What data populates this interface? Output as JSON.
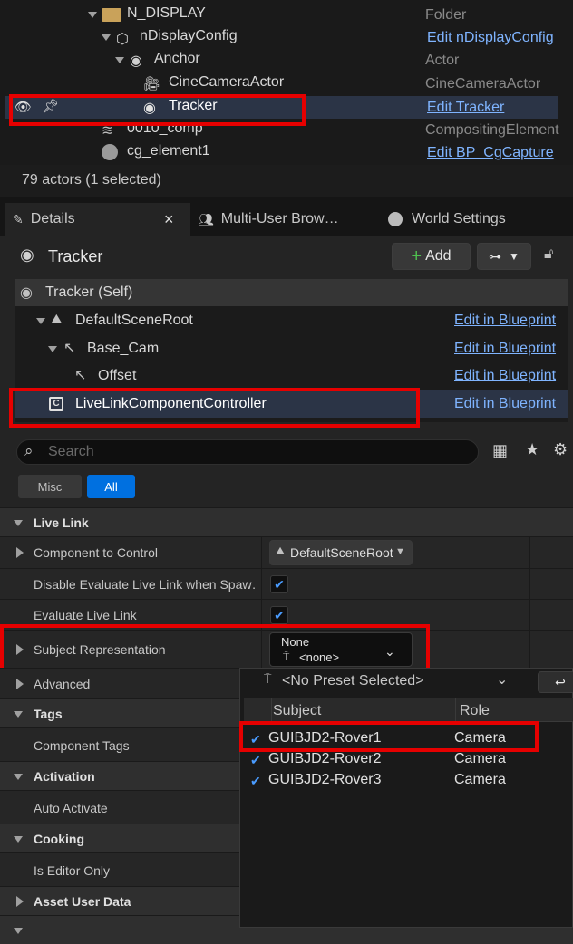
{
  "outliner": {
    "rows": [
      {
        "name": "N_DISPLAY",
        "type": "Folder"
      },
      {
        "name": "nDisplayConfig",
        "link": "Edit nDisplayConfig"
      },
      {
        "name": "Anchor",
        "type": "Actor"
      },
      {
        "name": "CineCameraActor",
        "type": "CineCameraActor"
      },
      {
        "name": "Tracker",
        "link": "Edit Tracker"
      },
      {
        "name": "0010_comp",
        "type": "CompositingElement"
      },
      {
        "name": "cg_element1",
        "link": "Edit BP_CgCapture"
      }
    ],
    "status": "79 actors (1 selected)"
  },
  "tabs": {
    "details": "Details",
    "details_close": "×",
    "multiuser": "Multi-User Brow…",
    "world": "World Settings"
  },
  "details": {
    "actor_name": "Tracker",
    "add_label": "Add",
    "components": [
      {
        "name": "Tracker (Self)"
      },
      {
        "name": "DefaultSceneRoot",
        "link": "Edit in Blueprint"
      },
      {
        "name": "Base_Cam",
        "link": "Edit in Blueprint"
      },
      {
        "name": "Offset",
        "link": "Edit in Blueprint"
      },
      {
        "name": "LiveLinkComponentController",
        "link": "Edit in Blueprint"
      }
    ],
    "search_placeholder": "Search",
    "filters": {
      "misc": "Misc",
      "all": "All"
    },
    "categories": {
      "live_link": "Live Link",
      "tags": "Tags",
      "activation": "Activation",
      "cooking": "Cooking",
      "asset_user_data": "Asset User Data"
    },
    "props": {
      "component_to_control": "Component to Control",
      "component_to_control_value": "DefaultSceneRoot",
      "disable_eval": "Disable Evaluate Live Link when Spaw…",
      "evaluate": "Evaluate Live Link",
      "subject_rep": "Subject Representation",
      "subject_rep_top": "None",
      "subject_rep_value": "<none>",
      "advanced": "Advanced",
      "component_tags": "Component Tags",
      "auto_activate": "Auto Activate",
      "editor_only": "Is Editor Only"
    }
  },
  "popup": {
    "preset": "<No Preset Selected>",
    "col_subject": "Subject",
    "col_role": "Role",
    "subjects": [
      {
        "name": "GUIBJD2-Rover1",
        "role": "Camera"
      },
      {
        "name": "GUIBJD2-Rover2",
        "role": "Camera"
      },
      {
        "name": "GUIBJD2-Rover3",
        "role": "Camera"
      }
    ]
  }
}
